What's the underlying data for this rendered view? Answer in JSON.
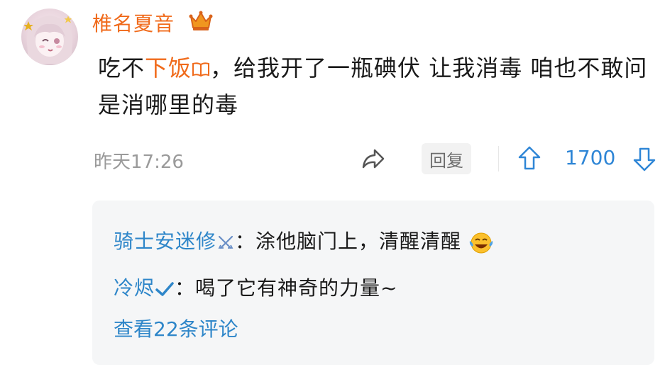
{
  "comment": {
    "username": "椎名夏音",
    "text_prefix": "吃不",
    "text_highlight": "下饭",
    "text_rest": "，给我开了一瓶碘伏 让我消毒 咱也不敢问是消哪里的毒",
    "timestamp": "昨天17:26",
    "reply_label": "回复",
    "vote_count": "1700"
  },
  "replies": [
    {
      "name": "骑士安迷修",
      "separator": "：",
      "text": "涂他脑门上，清醒清醒"
    },
    {
      "name": "冷烬",
      "separator": "：",
      "text": "喝了它有神奇的力量~"
    }
  ],
  "view_more": "查看22条评论",
  "colors": {
    "username": "#f06a1a",
    "link_blue": "#2e86c9",
    "vote_blue": "#2f86d6",
    "timestamp": "#9a9a9a",
    "reply_box_bg": "#f5f6f7"
  },
  "icons": {
    "crown": "crown-icon",
    "share": "share-icon",
    "upvote": "upvote-arrow-icon",
    "downvote": "downvote-arrow-icon",
    "book": "book-icon",
    "crossed_swords": "crossed-swords-icon",
    "checkmark": "checkmark-icon",
    "laughing_emoji": "laughing-tears-emoji-icon"
  }
}
